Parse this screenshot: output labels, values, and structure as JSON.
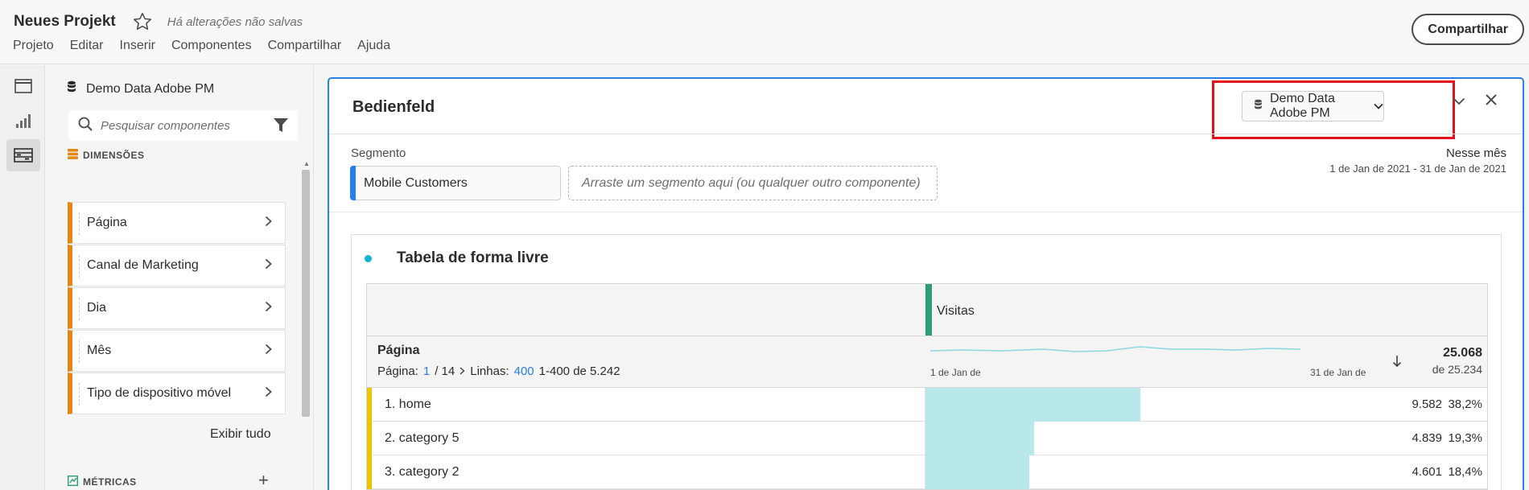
{
  "header": {
    "project_title": "Neues Projekt",
    "unsaved_text": "Há alterações não salvas",
    "menu": [
      "Projeto",
      "Editar",
      "Inserir",
      "Componentes",
      "Compartilhar",
      "Ajuda"
    ],
    "share_label": "Compartilhar"
  },
  "rail": {
    "icons": [
      "panel-icon",
      "visualizations-icon",
      "components-icon"
    ]
  },
  "components_panel": {
    "data_source": "Demo Data Adobe PM",
    "search_placeholder": "Pesquisar componentes",
    "dimensions_label": "DIMENSÕES",
    "dimensions": [
      "Página",
      "Canal de Marketing",
      "Dia",
      "Mês",
      "Tipo de dispositivo móvel"
    ],
    "show_all": "Exibir tudo",
    "metrics_label": "MÉTRICAS",
    "add_symbol": "+"
  },
  "panel": {
    "title": "Bedienfeld",
    "data_source": "Demo Data Adobe PM",
    "segment_label": "Segmento",
    "segment_chip": "Mobile Customers",
    "segment_drop_placeholder": "Arraste um segmento aqui (ou qualquer outro componente)",
    "date_title": "Nesse mês",
    "date_range": "1 de Jan de 2021 - 31 de Jan de 2021",
    "accent_color": "#2680eb",
    "highlight_color": "#e3111b"
  },
  "table": {
    "title": "Tabela de forma livre",
    "metric": "Visitas",
    "dimension": "Página",
    "pager": {
      "page_label": "Página:",
      "page": "1",
      "page_total": "/ 14",
      "rows_label": "Linhas:",
      "rows": "400",
      "range": "1-400 de 5.242"
    },
    "spark_start": "1 de Jan de",
    "spark_end": "31 de Jan de",
    "total": "25.068",
    "total_of": "de 25.234",
    "rows": [
      {
        "label": "1. home",
        "value": "9.582",
        "pct": "38,2%",
        "share": 0.382
      },
      {
        "label": "2. category 5",
        "value": "4.839",
        "pct": "19,3%",
        "share": 0.193
      },
      {
        "label": "3. category 2",
        "value": "4.601",
        "pct": "18,4%",
        "share": 0.184
      }
    ],
    "bar_color": "#b8e8ec"
  }
}
